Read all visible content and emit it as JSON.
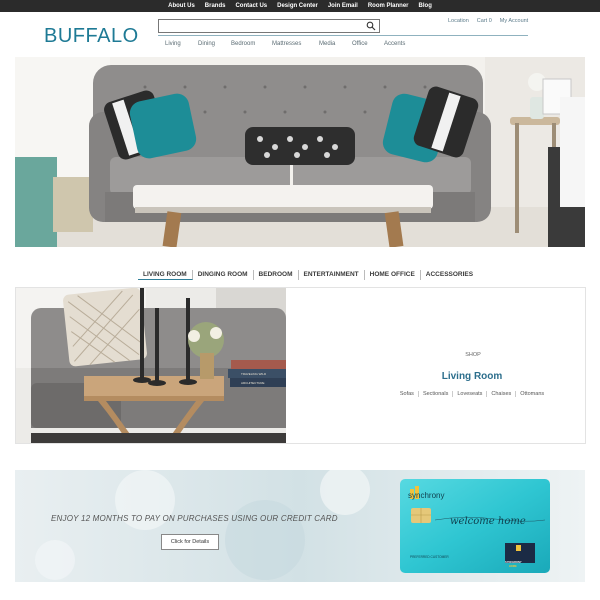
{
  "topbar": {
    "links": [
      "About Us",
      "Brands",
      "Contact Us",
      "Design Center",
      "Join Email",
      "Room Planner",
      "Blog"
    ]
  },
  "header": {
    "logo": "BUFFALO",
    "utility": [
      "Location",
      "Cart 0",
      "My Account"
    ],
    "nav": [
      "Living",
      "Dining",
      "Bedroom",
      "Mattresses",
      "Media",
      "Office",
      "Accents"
    ]
  },
  "room_tabs": {
    "items": [
      "LIVING ROOM",
      "DINGING ROOM",
      "BEDROOM",
      "ENTERTAINMENT",
      "HOME OFFICE",
      "ACCESSORIES"
    ],
    "active": "LIVING ROOM"
  },
  "feature": {
    "eyebrow": "SHOP",
    "title": "Living Room",
    "links": [
      "Sofas",
      "Sectionals",
      "Loveseats",
      "Chaises",
      "Ottomans"
    ],
    "book_titles": [
      "",
      "TRAVELING WILD",
      "ARCHITECTURE"
    ]
  },
  "credit": {
    "text": "ENJOY 12 MONTHS TO PAY ON PURCHASES USING OUR CREDIT CARD",
    "button": "Click for Details",
    "card_brand": "synchrony",
    "card_script": "welcome home",
    "card_type": "PREFERRED CUSTOMER",
    "card_logo_line1": "SYNCHRONY",
    "card_logo_line2": "HOME"
  },
  "colors": {
    "logo": "#1e7a95",
    "topbar": "#2b2b2b",
    "accent": "#2c6e8c",
    "card": "#2fc6d2"
  }
}
